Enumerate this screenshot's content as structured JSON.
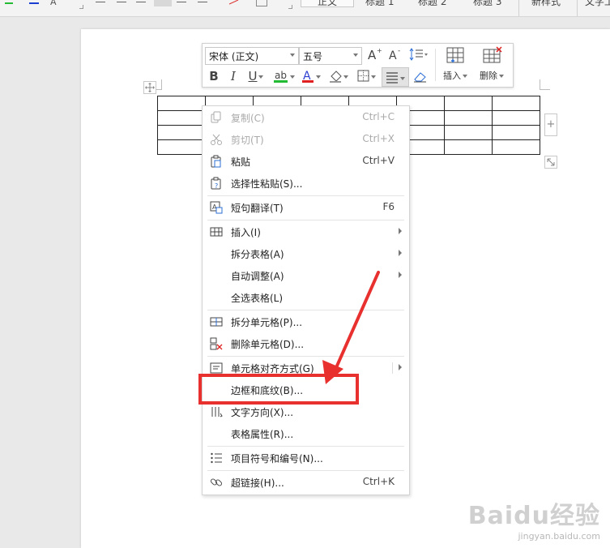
{
  "ribbon_fragments": {
    "style_text": "正文",
    "heading1": "标题 1",
    "heading2": "标题 2",
    "heading3": "标题 3",
    "new_style": "新样式",
    "text_tool": "文字工"
  },
  "mini_toolbar": {
    "font_name": "宋体 (正文)",
    "font_size": "五号",
    "insert_label": "插入",
    "delete_label": "删除"
  },
  "context_menu": {
    "copy": {
      "label": "复制(C)",
      "shortcut": "Ctrl+C"
    },
    "cut": {
      "label": "剪切(T)",
      "shortcut": "Ctrl+X"
    },
    "paste": {
      "label": "粘贴",
      "shortcut": "Ctrl+V"
    },
    "paste_special": {
      "label": "选择性粘贴(S)..."
    },
    "translate": {
      "label": "短句翻译(T)",
      "shortcut": "F6"
    },
    "insert": {
      "label": "插入(I)"
    },
    "split_table": {
      "label": "拆分表格(A)"
    },
    "auto_fit": {
      "label": "自动调整(A)"
    },
    "select_table": {
      "label": "全选表格(L)"
    },
    "split_cells": {
      "label": "拆分单元格(P)..."
    },
    "delete_cells": {
      "label": "删除单元格(D)..."
    },
    "cell_alignment": {
      "label": "单元格对齐方式(G)"
    },
    "borders_shading": {
      "label": "边框和底纹(B)..."
    },
    "text_direction": {
      "label": "文字方向(X)..."
    },
    "table_properties": {
      "label": "表格属性(R)..."
    },
    "bullets_numbering": {
      "label": "项目符号和编号(N)..."
    },
    "hyperlink": {
      "label": "超链接(H)...",
      "shortcut": "Ctrl+K"
    }
  },
  "watermark": {
    "brand": "Baidu经验",
    "url": "jingyan.baidu.com"
  },
  "colors": {
    "annotation_red": "#e8302f",
    "highlight_green": "#22bb33",
    "font_color_red": "#e02020",
    "toolbar_blue": "#2d6fd6"
  },
  "icons": [
    "copy-icon",
    "cut-icon",
    "paste-icon",
    "paste-special-icon",
    "translate-icon",
    "insert-table-icon",
    "split-cells-icon",
    "delete-cells-icon",
    "cell-align-icon",
    "text-direction-icon",
    "bullets-icon",
    "hyperlink-icon"
  ]
}
